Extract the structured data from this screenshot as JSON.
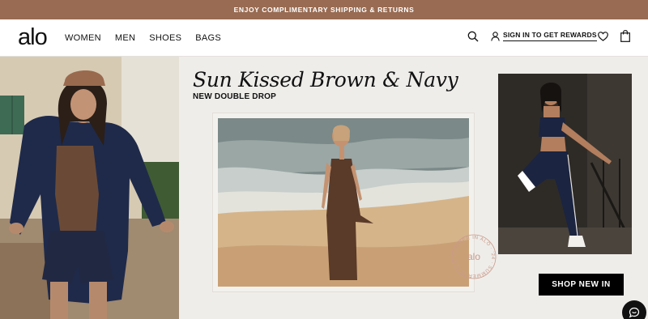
{
  "promo": {
    "text": "ENJOY COMPLIMENTARY SHIPPING & RETURNS"
  },
  "header": {
    "logo": "alo",
    "nav": [
      "WOMEN",
      "MEN",
      "SHOES",
      "BAGS"
    ],
    "sign_in": "SIGN IN TO GET REWARDS"
  },
  "hero": {
    "headline": "Sun Kissed Brown & Navy",
    "subhead": "NEW DOUBLE DROP",
    "cta": "SHOP NEW IN",
    "stamp_text": "SUMMER IN ALO · '24 · SUMMER IN ALO '24 ·",
    "stamp_logo": "alo"
  },
  "colors": {
    "promo_bg": "#986b52",
    "page_bg": "#efedea",
    "cta_bg": "#000000",
    "stamp": "#c99a8a"
  },
  "icons": [
    "search-icon",
    "user-icon",
    "heart-icon",
    "shopping-bag-icon",
    "chat-icon"
  ]
}
